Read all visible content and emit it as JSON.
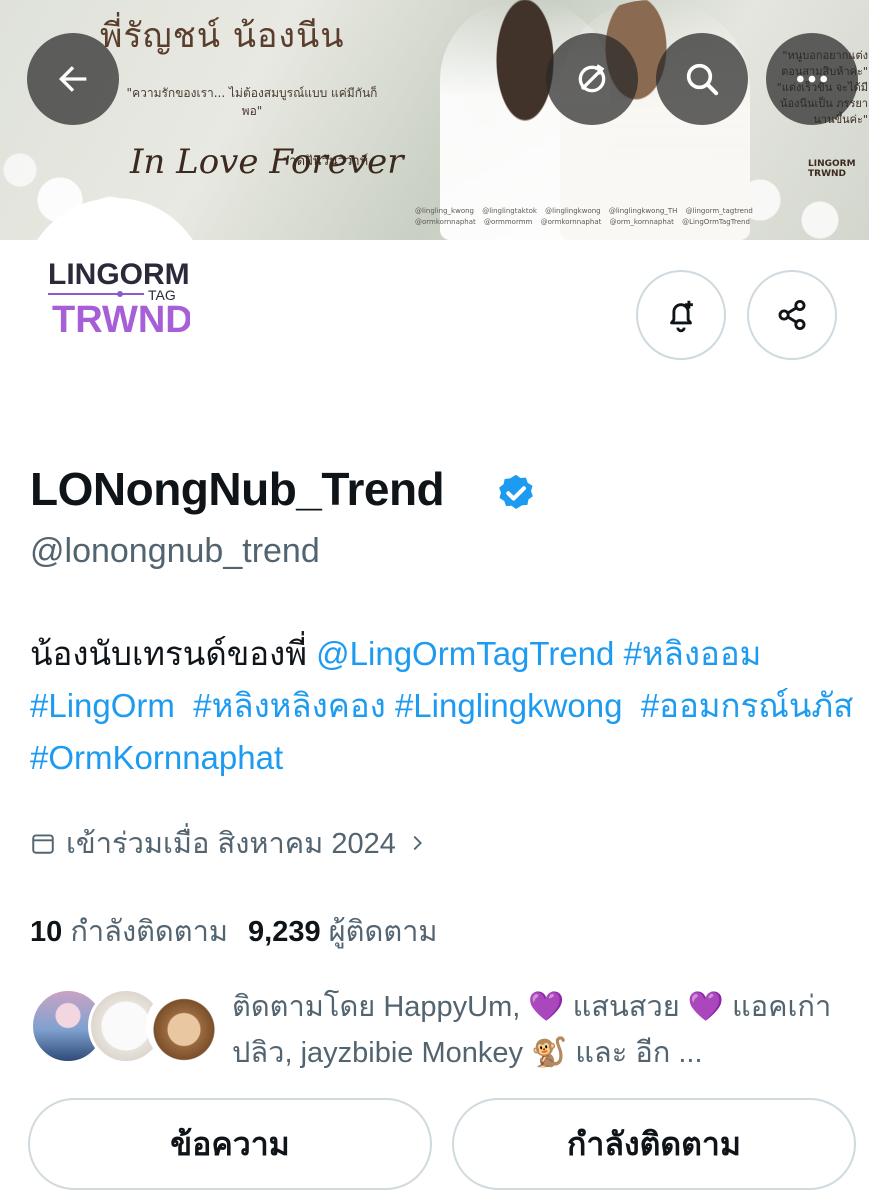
{
  "banner": {
    "title": "พี่รัญชน์ น้องนีน",
    "quote": "\"ความรักของเรา... ไม่ต้องสมบูรณ์แบบ แค่มีกันก็พอ\"",
    "script_title": "In Love Forever",
    "script_sub": "วาดฝันวันวิวาห์",
    "right_quote": "\"หนูบอกอยากแต่ง ตอนสามสิบห้าค่ะ\" \"แต่งเร็วขึ้น จะได้มี น้องนีนเป็น ภรรยา นานขึ้นค่ะ\"",
    "mini_logo": "LINGORM TRWND",
    "handles": "@lingling_kwong @linglingtaktok @linglingkwong @linglingkwong_TH @lingorm_tagtrend @ormkornnaphat @ormmormm @ormkornnaphat @orm_kornnaphat @LingOrmTagTrend"
  },
  "top_bar": {
    "back_icon": "arrow-left-icon",
    "translate_icon": "no-filter-icon",
    "search_icon": "search-icon",
    "more_icon": "more-dots-icon"
  },
  "avatar": {
    "logo_line1": "LINGORM",
    "logo_tag": "TAG",
    "logo_line2": "TRWND"
  },
  "actions": {
    "notify_icon": "bell-plus-icon",
    "share_icon": "share-icon"
  },
  "profile": {
    "display_name": "LONongNub_Trend",
    "handle": "@lonongnub_trend",
    "bio_text": "น้องนับเทรนด์ของพี่ ",
    "bio_mention": "@LingOrmTagTrend",
    "bio_tags": [
      "#หลิงออม",
      "#LingOrm",
      "#หลิงหลิงคอง",
      "#Linglingkwong",
      "#ออมกรณ์นภัส",
      "#OrmKornnaphat"
    ],
    "joined": "เข้าร่วมเมื่อ สิงหาคม 2024",
    "following_count": "10",
    "following_label": "กำลังติดตาม",
    "followers_count": "9,239",
    "followers_label": "ผู้ติดตาม",
    "followed_by": "ติดตามโดย HappyUm, 💜 แสนสวย 💜 แอคเก่าปลิว, jayzbibie Monkey 🐒 และ อีก ..."
  },
  "buttons": {
    "message": "ข้อความ",
    "following": "กำลังติดตาม"
  },
  "colors": {
    "link": "#1d9bf0",
    "verified": "#1d9bf0",
    "secondary_text": "#536471",
    "border": "#cfd9de"
  }
}
